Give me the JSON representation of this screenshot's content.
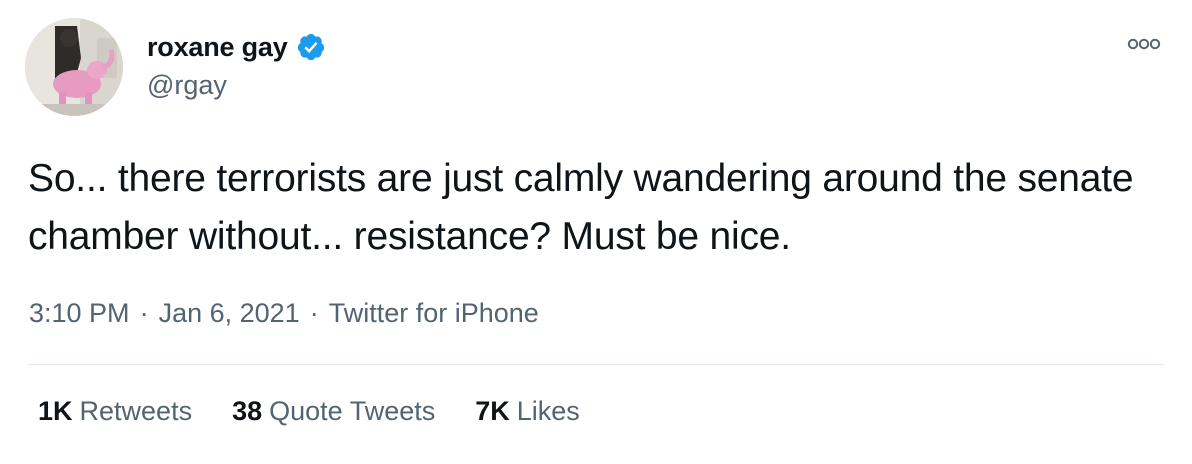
{
  "author": {
    "display_name": "roxane gay",
    "handle": "@rgay",
    "verified_icon": "verified-badge-icon",
    "avatar_icon": "profile-photo"
  },
  "colors": {
    "verified_blue": "#1d9bf0",
    "text_primary": "#0f1419",
    "text_secondary": "#536471",
    "divider": "#e1e8ed"
  },
  "more_icon": "more-options-icon",
  "tweet": {
    "text": "So... there terrorists are just calmly wandering around the senate chamber without... resistance? Must be nice."
  },
  "meta": {
    "time": "3:10 PM",
    "separator": "·",
    "date": "Jan 6, 2021",
    "source": "Twitter for iPhone"
  },
  "stats": {
    "retweets_count": "1K",
    "retweets_label": "Retweets",
    "quotes_count": "38",
    "quotes_label": "Quote Tweets",
    "likes_count": "7K",
    "likes_label": "Likes"
  }
}
